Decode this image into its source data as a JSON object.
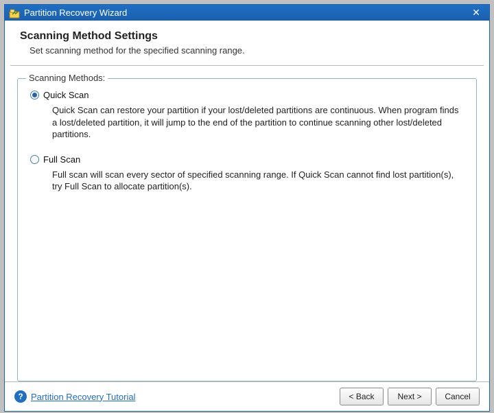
{
  "window": {
    "title": "Partition Recovery Wizard"
  },
  "header": {
    "title": "Scanning Method Settings",
    "subtitle": "Set scanning method for the specified scanning range."
  },
  "group": {
    "legend": "Scanning Methods:",
    "options": [
      {
        "label": "Quick Scan",
        "selected": true,
        "desc": "Quick Scan can restore your partition if your lost/deleted partitions are continuous. When program finds a lost/deleted partition, it will jump to the end of the partition to continue scanning other lost/deleted partitions."
      },
      {
        "label": "Full Scan",
        "selected": false,
        "desc": "Full scan will scan every sector of specified scanning range. If Quick Scan cannot find lost partition(s), try Full Scan to allocate partition(s)."
      }
    ]
  },
  "footer": {
    "tutorial_link": "Partition Recovery Tutorial",
    "buttons": {
      "back": "< Back",
      "next": "Next >",
      "cancel": "Cancel"
    }
  }
}
